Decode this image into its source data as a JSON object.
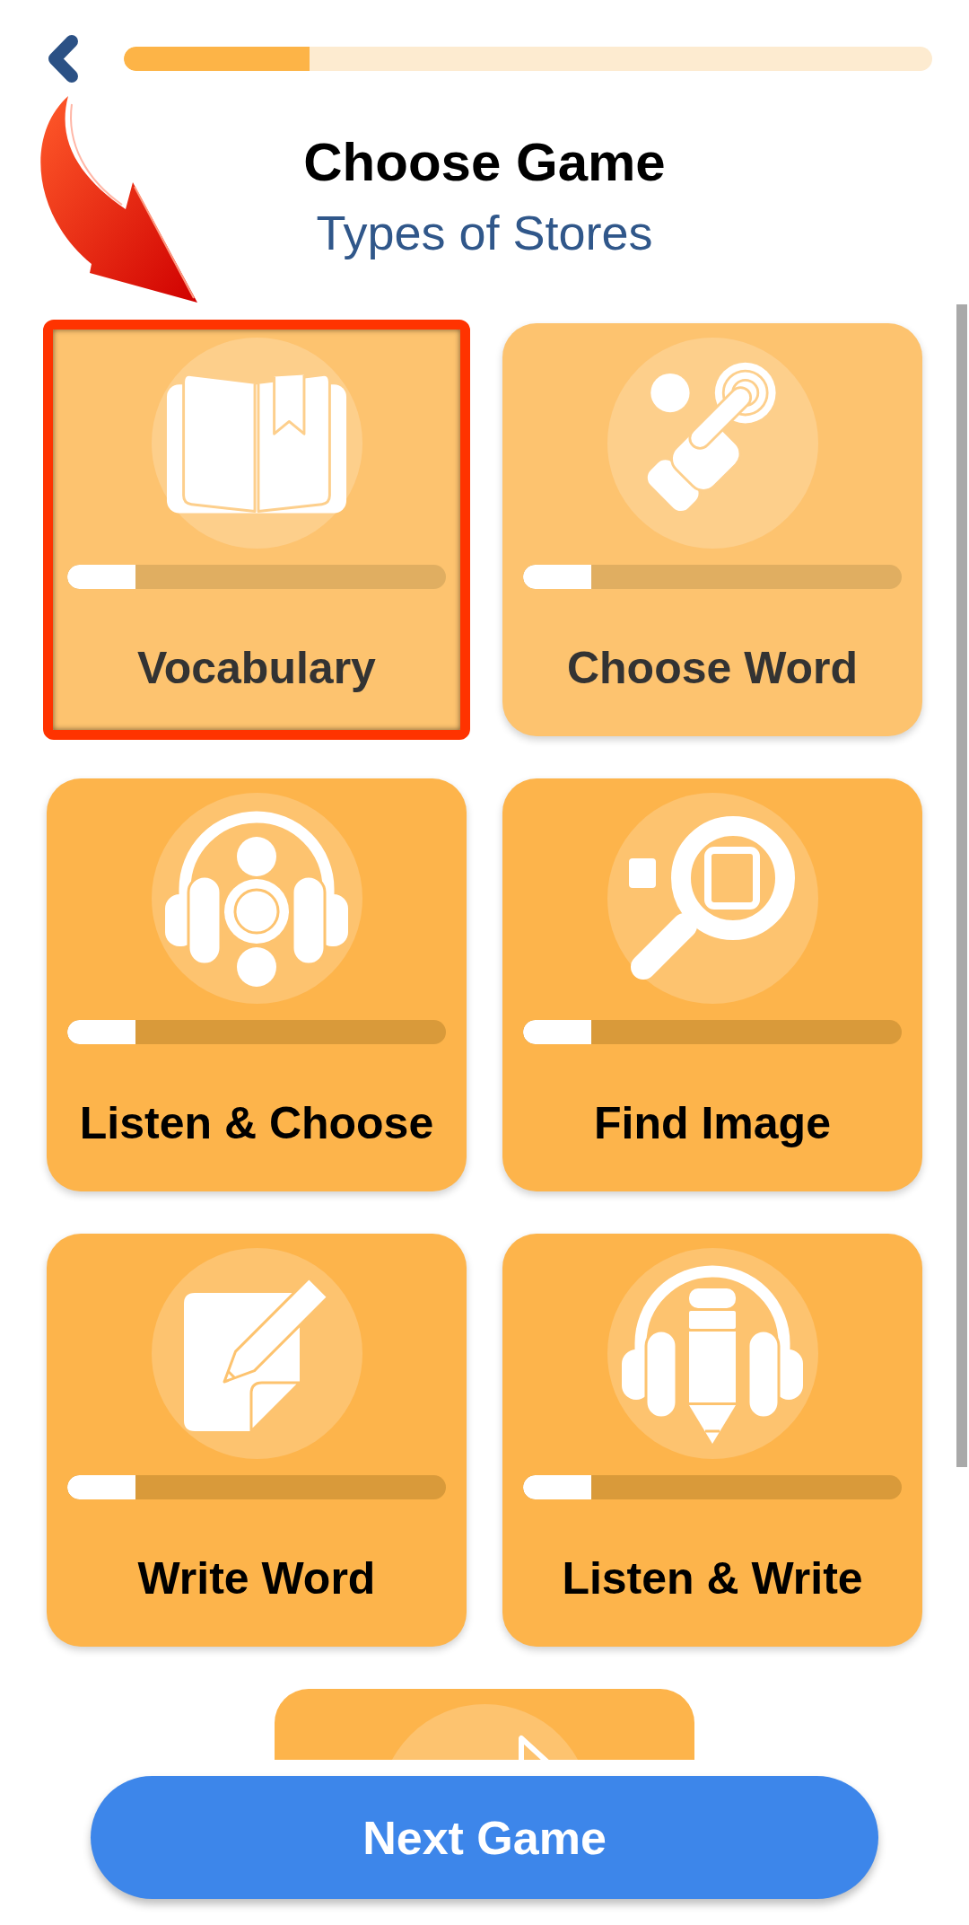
{
  "progress": {
    "level": 0.23
  },
  "title": "Choose Game",
  "subtitle": "Types of Stores",
  "cards": [
    {
      "kind": "book",
      "label": "Vocabulary",
      "level": 0.18,
      "selected": true,
      "dimmed": true
    },
    {
      "kind": "tap",
      "label": "Choose Word",
      "level": 0.18,
      "selected": false,
      "dimmed": true
    },
    {
      "kind": "listen",
      "label": "Listen & Choose",
      "level": 0.18,
      "selected": false,
      "dimmed": false
    },
    {
      "kind": "search",
      "label": "Find Image",
      "level": 0.18,
      "selected": false,
      "dimmed": false
    },
    {
      "kind": "write",
      "label": "Write Word",
      "level": 0.18,
      "selected": false,
      "dimmed": false
    },
    {
      "kind": "dictation",
      "label": "Listen & Write",
      "level": 0.18,
      "selected": false,
      "dimmed": false
    }
  ],
  "partial_card": {
    "kind": "pointer",
    "dimmed": false
  },
  "next_button": {
    "label": "Next Game"
  }
}
